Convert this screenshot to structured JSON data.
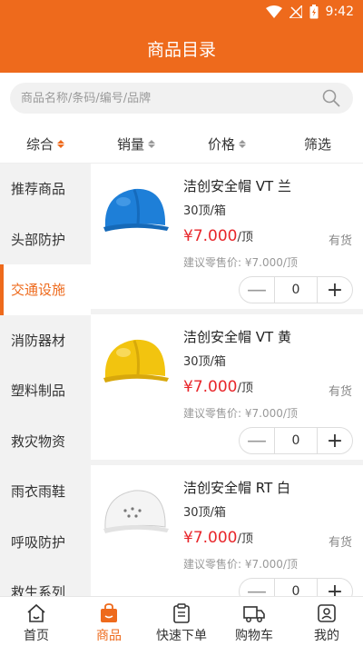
{
  "status_bar": {
    "time": "9:42"
  },
  "header": {
    "title": "商品目录"
  },
  "search": {
    "placeholder": "商品名称/条码/编号/品牌"
  },
  "sort_tabs": [
    {
      "label": "综合",
      "active": true
    },
    {
      "label": "销量"
    },
    {
      "label": "价格"
    },
    {
      "label": "筛选"
    }
  ],
  "categories": [
    {
      "label": "推荐商品"
    },
    {
      "label": "头部防护"
    },
    {
      "label": "交通设施",
      "active": true
    },
    {
      "label": "消防器材"
    },
    {
      "label": "塑料制品"
    },
    {
      "label": "救灾物资"
    },
    {
      "label": "雨衣雨鞋"
    },
    {
      "label": "呼吸防护"
    },
    {
      "label": "救生系列"
    }
  ],
  "products": [
    {
      "name": "洁创安全帽 VT 兰",
      "spec": "30顶/箱",
      "price": "¥7.000",
      "unit": "/顶",
      "stock": "有货",
      "msrp": "建议零售价: ¥7.000/顶",
      "qty": "0",
      "color": "#1e7fd8"
    },
    {
      "name": "洁创安全帽 VT 黄",
      "spec": "30顶/箱",
      "price": "¥7.000",
      "unit": "/顶",
      "stock": "有货",
      "msrp": "建议零售价: ¥7.000/顶",
      "qty": "0",
      "color": "#f2c40f"
    },
    {
      "name": "洁创安全帽 RT 白",
      "spec": "30顶/箱",
      "price": "¥7.000",
      "unit": "/顶",
      "stock": "有货",
      "msrp": "建议零售价: ¥7.000/顶",
      "qty": "0",
      "color": "#f4f4f4"
    }
  ],
  "bottom_nav": [
    {
      "label": "首页",
      "icon": "home-icon"
    },
    {
      "label": "商品",
      "icon": "bag-icon",
      "active": true
    },
    {
      "label": "快速下单",
      "icon": "clipboard-icon"
    },
    {
      "label": "购物车",
      "icon": "truck-icon"
    },
    {
      "label": "我的",
      "icon": "user-icon"
    }
  ],
  "colors": {
    "accent": "#ee6a1c",
    "price": "#e8262b"
  }
}
